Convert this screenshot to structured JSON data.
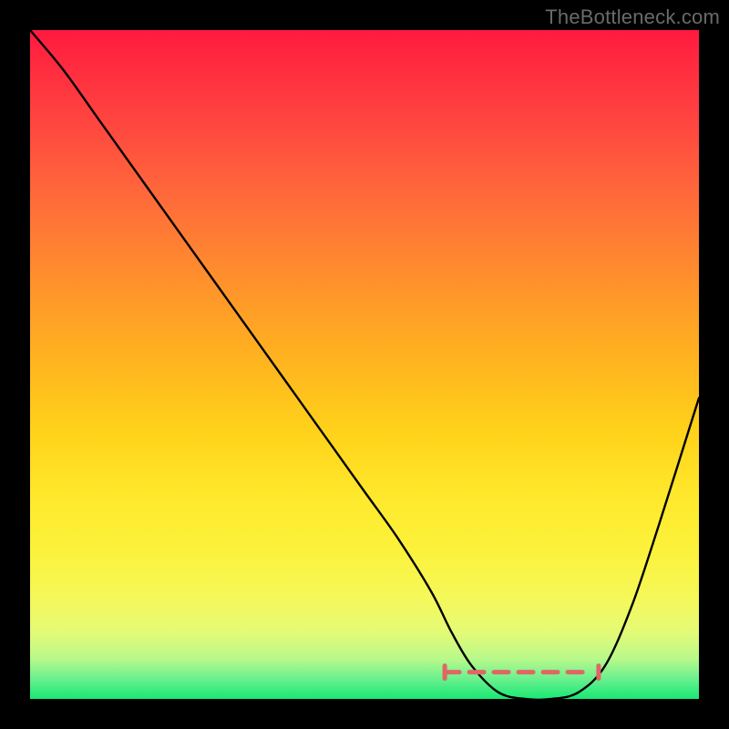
{
  "watermark": "TheBottleneck.com",
  "chart_data": {
    "type": "line",
    "title": "",
    "xlabel": "",
    "ylabel": "",
    "xlim": [
      0,
      100
    ],
    "ylim": [
      0,
      100
    ],
    "grid": false,
    "background_gradient": {
      "top_color": "#ff1a3f",
      "bottom_color": "#18e874"
    },
    "series": [
      {
        "name": "bottleneck-curve",
        "color": "#000000",
        "x": [
          0,
          5,
          10,
          15,
          20,
          25,
          30,
          35,
          40,
          45,
          50,
          55,
          60,
          63,
          66,
          70,
          74,
          78,
          82,
          86,
          90,
          94,
          100
        ],
        "values": [
          100,
          94,
          87,
          80,
          73,
          66,
          59,
          52,
          45,
          38,
          31,
          24,
          16,
          10,
          5,
          1,
          0,
          0,
          1,
          5,
          14,
          26,
          45
        ]
      }
    ],
    "annotations": [
      {
        "name": "optimal-range-dashes",
        "kind": "dash-segment-row",
        "color": "#e06666",
        "y": 4,
        "x_start": 62,
        "x_end": 85
      }
    ]
  }
}
